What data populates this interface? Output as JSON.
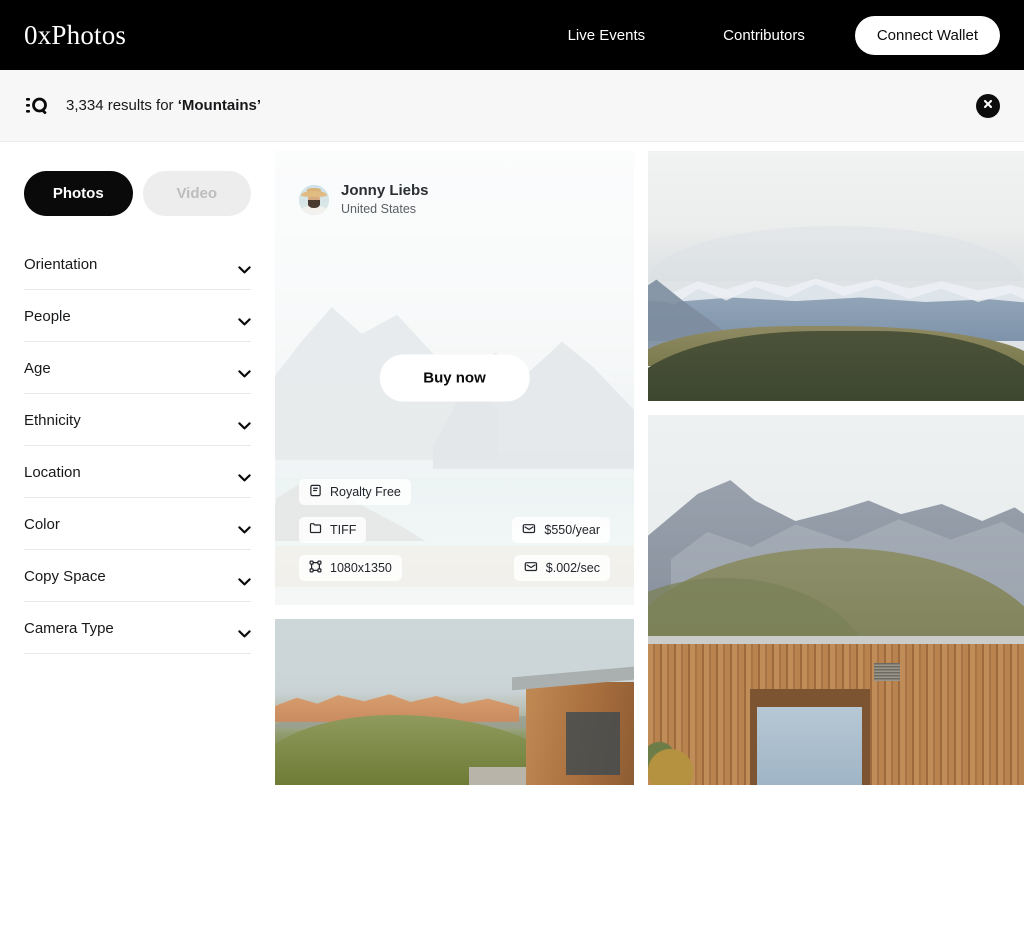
{
  "header": {
    "logo": "0xPhotos",
    "nav": [
      {
        "label": "Live Events"
      },
      {
        "label": "Contributors"
      }
    ],
    "wallet_button": "Connect Wallet",
    "background_color": "#000000"
  },
  "search": {
    "icon": "filter-search-icon",
    "results_count": "3,334",
    "results_prefix": "3,334 results for ",
    "query": "‘Mountains’",
    "close_icon": "close-circle-icon"
  },
  "sidebar": {
    "toggle": {
      "photos": {
        "label": "Photos",
        "active": true
      },
      "video": {
        "label": "Video",
        "active": false
      }
    },
    "filters": [
      {
        "label": "Orientation",
        "expanded": false
      },
      {
        "label": "People",
        "expanded": false
      },
      {
        "label": "Age",
        "expanded": false
      },
      {
        "label": "Ethnicity",
        "expanded": false
      },
      {
        "label": "Location",
        "expanded": false
      },
      {
        "label": "Color",
        "expanded": false
      },
      {
        "label": "Copy Space",
        "expanded": false
      },
      {
        "label": "Camera Type",
        "expanded": false
      }
    ]
  },
  "featured_card": {
    "author": {
      "name": "Jonny Liebs",
      "location": "United States",
      "avatar": "photographer-avatar"
    },
    "buy_button": "Buy now",
    "badges": {
      "license": {
        "label": "Royalty Free",
        "icon": "license-document-icon"
      },
      "format": {
        "label": "TIFF",
        "icon": "folder-icon"
      },
      "dimensions": {
        "label": "1080x1350",
        "icon": "resize-icon"
      },
      "price_year": {
        "label": "$550/year",
        "icon": "card-icon"
      },
      "price_sec": {
        "label": "$.002/sec",
        "icon": "card-icon"
      }
    }
  },
  "gallery": {
    "photos": [
      {
        "name": "hazy-lake-mountains",
        "alt": "Hazy mountain lake"
      },
      {
        "name": "sunset-mountain-house",
        "alt": "Sunset mountains with wooden house"
      },
      {
        "name": "snow-capped-range",
        "alt": "Snow capped mountain range"
      },
      {
        "name": "rocky-peak-wood-cabin",
        "alt": "Rocky peak above wood-slat cabin"
      }
    ]
  },
  "colors": {
    "accent": "#000000",
    "page_bg": "#ffffff",
    "searchbar_bg": "#f7f7f7",
    "inactive_tab_bg": "#ededed",
    "inactive_tab_text": "#bdbdbd",
    "divider": "#e8e8e8"
  }
}
